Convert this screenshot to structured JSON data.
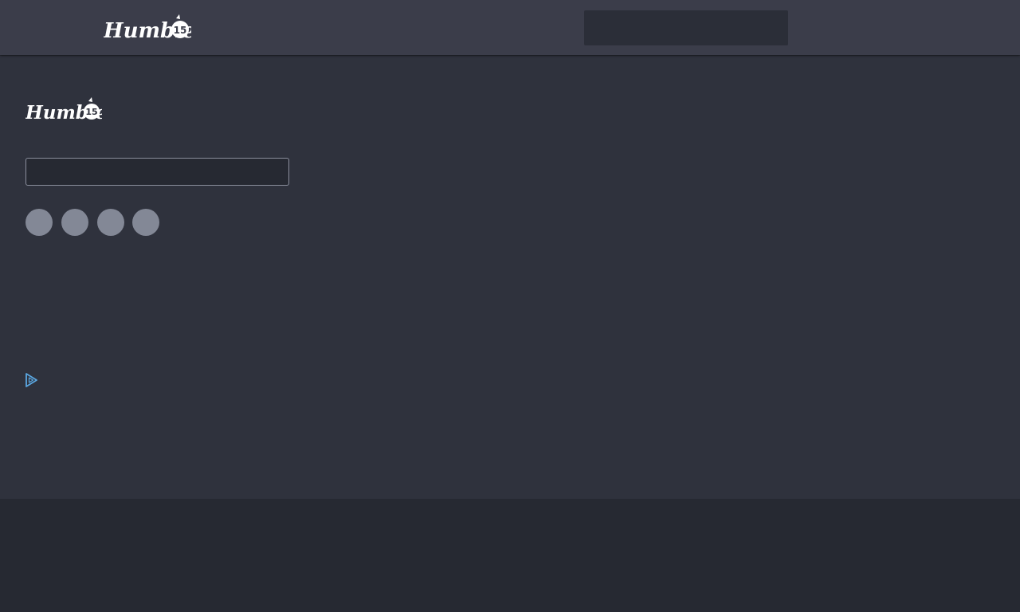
{
  "header": {
    "logo_text": "Humble",
    "logo_badge": "15",
    "search": {
      "value": "",
      "placeholder": ""
    }
  },
  "footer": {
    "logo_text": "Humble",
    "logo_badge": "15",
    "newsletter": {
      "value": "",
      "placeholder": ""
    },
    "social_links": [
      {
        "icon": "social-icon-1"
      },
      {
        "icon": "social-icon-2"
      },
      {
        "icon": "social-icon-3"
      },
      {
        "icon": "social-icon-4"
      }
    ],
    "adchoices_icon": "adchoices-icon"
  },
  "colors": {
    "header_bg": "#3b3d4a",
    "footer_bg": "#2f323d",
    "page_bg": "#262932",
    "social_circle": "#838896",
    "adchoices": "#5aa6e0",
    "logo": "#ffffff"
  }
}
